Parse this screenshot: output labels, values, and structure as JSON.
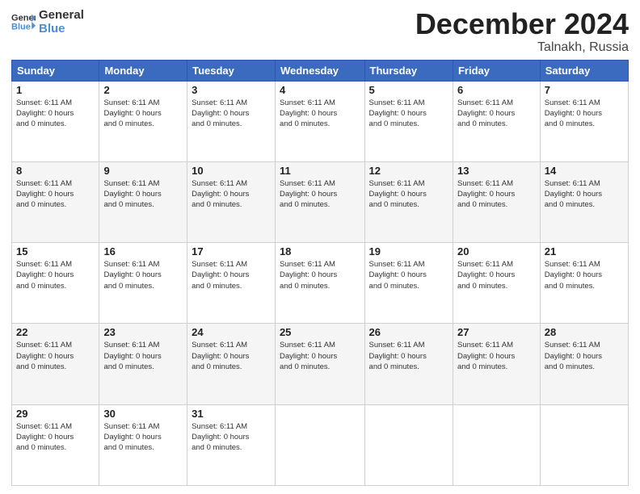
{
  "logo": {
    "line1": "General",
    "line2": "Blue"
  },
  "title": "December 2024",
  "subtitle": "Talnakh, Russia",
  "days_of_week": [
    "Sunday",
    "Monday",
    "Tuesday",
    "Wednesday",
    "Thursday",
    "Friday",
    "Saturday"
  ],
  "cell_info": "Sunset: 6:11 AM\nDaylight: 0 hours and 0 minutes.",
  "weeks": [
    [
      {
        "day": "1",
        "info": "Sunset: 6:11 AM\nDaylight: 0 hours\nand 0 minutes."
      },
      {
        "day": "2",
        "info": "Sunset: 6:11 AM\nDaylight: 0 hours\nand 0 minutes."
      },
      {
        "day": "3",
        "info": "Sunset: 6:11 AM\nDaylight: 0 hours\nand 0 minutes."
      },
      {
        "day": "4",
        "info": "Sunset: 6:11 AM\nDaylight: 0 hours\nand 0 minutes."
      },
      {
        "day": "5",
        "info": "Sunset: 6:11 AM\nDaylight: 0 hours\nand 0 minutes."
      },
      {
        "day": "6",
        "info": "Sunset: 6:11 AM\nDaylight: 0 hours\nand 0 minutes."
      },
      {
        "day": "7",
        "info": "Sunset: 6:11 AM\nDaylight: 0 hours\nand 0 minutes."
      }
    ],
    [
      {
        "day": "8",
        "info": "Sunset: 6:11 AM\nDaylight: 0 hours\nand 0 minutes."
      },
      {
        "day": "9",
        "info": "Sunset: 6:11 AM\nDaylight: 0 hours\nand 0 minutes."
      },
      {
        "day": "10",
        "info": "Sunset: 6:11 AM\nDaylight: 0 hours\nand 0 minutes."
      },
      {
        "day": "11",
        "info": "Sunset: 6:11 AM\nDaylight: 0 hours\nand 0 minutes."
      },
      {
        "day": "12",
        "info": "Sunset: 6:11 AM\nDaylight: 0 hours\nand 0 minutes."
      },
      {
        "day": "13",
        "info": "Sunset: 6:11 AM\nDaylight: 0 hours\nand 0 minutes."
      },
      {
        "day": "14",
        "info": "Sunset: 6:11 AM\nDaylight: 0 hours\nand 0 minutes."
      }
    ],
    [
      {
        "day": "15",
        "info": "Sunset: 6:11 AM\nDaylight: 0 hours\nand 0 minutes."
      },
      {
        "day": "16",
        "info": "Sunset: 6:11 AM\nDaylight: 0 hours\nand 0 minutes."
      },
      {
        "day": "17",
        "info": "Sunset: 6:11 AM\nDaylight: 0 hours\nand 0 minutes."
      },
      {
        "day": "18",
        "info": "Sunset: 6:11 AM\nDaylight: 0 hours\nand 0 minutes."
      },
      {
        "day": "19",
        "info": "Sunset: 6:11 AM\nDaylight: 0 hours\nand 0 minutes."
      },
      {
        "day": "20",
        "info": "Sunset: 6:11 AM\nDaylight: 0 hours\nand 0 minutes."
      },
      {
        "day": "21",
        "info": "Sunset: 6:11 AM\nDaylight: 0 hours\nand 0 minutes."
      }
    ],
    [
      {
        "day": "22",
        "info": "Sunset: 6:11 AM\nDaylight: 0 hours\nand 0 minutes."
      },
      {
        "day": "23",
        "info": "Sunset: 6:11 AM\nDaylight: 0 hours\nand 0 minutes."
      },
      {
        "day": "24",
        "info": "Sunset: 6:11 AM\nDaylight: 0 hours\nand 0 minutes."
      },
      {
        "day": "25",
        "info": "Sunset: 6:11 AM\nDaylight: 0 hours\nand 0 minutes."
      },
      {
        "day": "26",
        "info": "Sunset: 6:11 AM\nDaylight: 0 hours\nand 0 minutes."
      },
      {
        "day": "27",
        "info": "Sunset: 6:11 AM\nDaylight: 0 hours\nand 0 minutes."
      },
      {
        "day": "28",
        "info": "Sunset: 6:11 AM\nDaylight: 0 hours\nand 0 minutes."
      }
    ],
    [
      {
        "day": "29",
        "info": "Sunset: 6:11 AM\nDaylight: 0 hours\nand 0 minutes."
      },
      {
        "day": "30",
        "info": "Sunset: 6:11 AM\nDaylight: 0 hours\nand 0 minutes."
      },
      {
        "day": "31",
        "info": "Sunset: 6:11 AM\nDaylight: 0 hours\nand 0 minutes."
      },
      {
        "day": "",
        "info": ""
      },
      {
        "day": "",
        "info": ""
      },
      {
        "day": "",
        "info": ""
      },
      {
        "day": "",
        "info": ""
      }
    ]
  ]
}
